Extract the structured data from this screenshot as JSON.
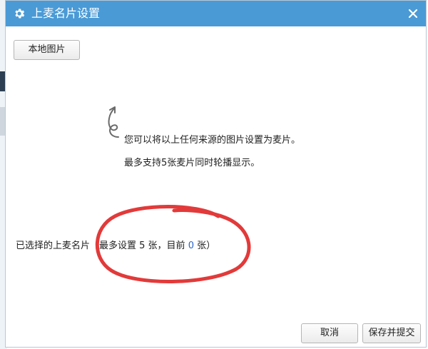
{
  "dialog": {
    "title": "上麦名片设置",
    "title_icon": "gear-icon",
    "close_icon": "close-icon"
  },
  "toolbar": {
    "local_image_label": "本地图片"
  },
  "hint": {
    "icon": "curly-arrow-icon",
    "line1": "您可以将以上任何来源的图片设置为麦片。",
    "line2": "最多支持5张麦片同时轮播显示。"
  },
  "selected": {
    "label": "已选择的上麦名片",
    "info_prefix": "（最多设置 5 张，目前 ",
    "current_count": "0",
    "info_suffix": " 张）"
  },
  "footer": {
    "cancel_label": "取消",
    "save_label": "保存并提交"
  },
  "annotation": {
    "color": "#e23a3a"
  },
  "colors": {
    "titlebar": "#4a9ad6",
    "count_highlight": "#2a64c8"
  }
}
